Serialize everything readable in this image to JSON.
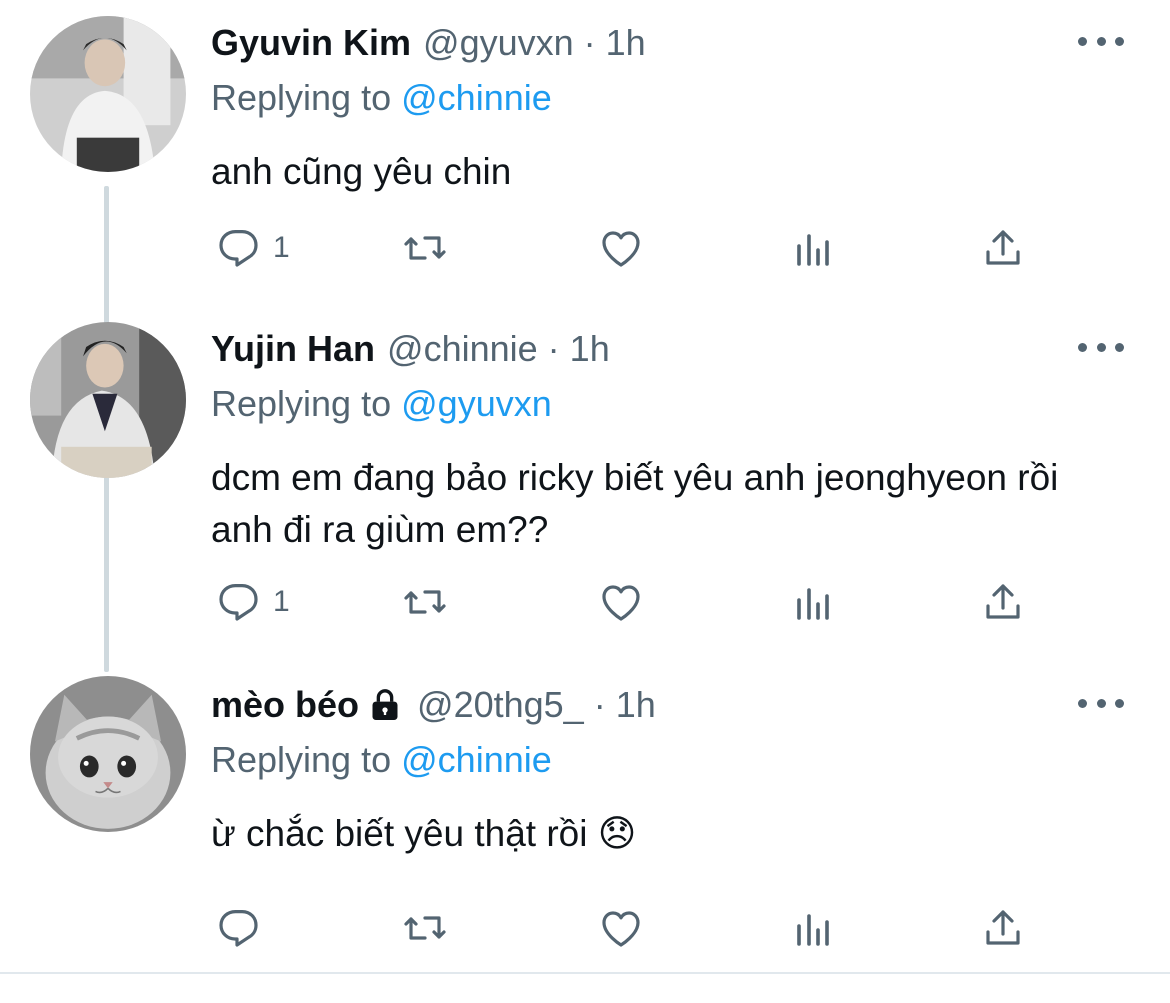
{
  "tweets": [
    {
      "display_name": "Gyuvin Kim",
      "handle": "@gyuvxn",
      "time": "1h",
      "replying_label": "Replying to",
      "replying_to": "@chinnie",
      "text": "anh cũng yêu chin",
      "reply_count": "1",
      "locked": false,
      "avatar": "person-photo"
    },
    {
      "display_name": "Yujin Han",
      "handle": "@chinnie",
      "time": "1h",
      "replying_label": "Replying to",
      "replying_to": "@gyuvxn",
      "text": "dcm em đang bảo ricky biết yêu anh jeonghyeon rồi anh đi ra giùm em??",
      "reply_count": "1",
      "locked": false,
      "avatar": "person-photo"
    },
    {
      "display_name": "mèo béo",
      "handle": "@20thg5_",
      "time": "1h",
      "replying_label": "Replying to",
      "replying_to": "@chinnie",
      "text": "ừ chắc biết yêu thật rồi 😞",
      "reply_count": "",
      "locked": true,
      "avatar": "kitten-photo"
    }
  ],
  "meta_separator": "·",
  "icons": [
    "reply-icon",
    "retweet-icon",
    "like-icon",
    "analytics-icon",
    "share-icon",
    "more-icon",
    "lock-icon"
  ],
  "colors": {
    "text": "#0f1419",
    "secondary": "#536471",
    "link": "#1d9bf0",
    "thread_line": "#cfd9de"
  }
}
